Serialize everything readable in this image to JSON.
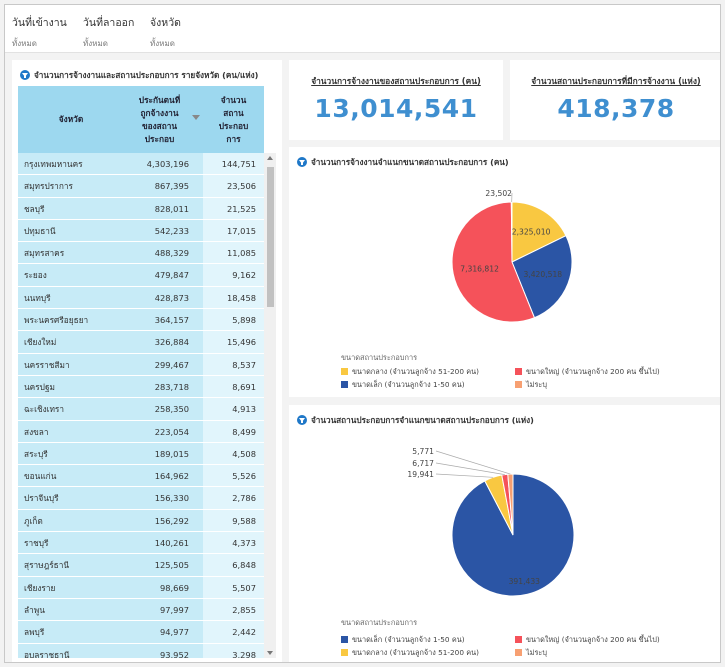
{
  "filters": [
    {
      "label": "วันที่เข้างาน",
      "value": "ทั้งหมด"
    },
    {
      "label": "วันที่ลาออก",
      "value": "ทั้งหมด"
    },
    {
      "label": "จังหวัด",
      "value": "ทั้งหมด"
    }
  ],
  "table_panel": {
    "title": "จำนวนการจ้างงานและสถานประกอบการ รายจังหวัด (คน/แห่ง)",
    "columns": [
      "จังหวัด",
      "ประกันตนที่ถูกจ้างงานของสถานประกอบ",
      "จำนวนสถานประกอบการ"
    ],
    "rows": [
      {
        "province": "กรุงเทพมหานคร",
        "insured": "4,303,196",
        "establishments": "144,751"
      },
      {
        "province": "สมุทรปราการ",
        "insured": "867,395",
        "establishments": "23,506"
      },
      {
        "province": "ชลบุรี",
        "insured": "828,011",
        "establishments": "21,525"
      },
      {
        "province": "ปทุมธานี",
        "insured": "542,233",
        "establishments": "17,015"
      },
      {
        "province": "สมุทรสาคร",
        "insured": "488,329",
        "establishments": "11,085"
      },
      {
        "province": "ระยอง",
        "insured": "479,847",
        "establishments": "9,162"
      },
      {
        "province": "นนทบุรี",
        "insured": "428,873",
        "establishments": "18,458"
      },
      {
        "province": "พระนครศรีอยุธยา",
        "insured": "364,157",
        "establishments": "5,898"
      },
      {
        "province": "เชียงใหม่",
        "insured": "326,884",
        "establishments": "15,496"
      },
      {
        "province": "นครราชสีมา",
        "insured": "299,467",
        "establishments": "8,537"
      },
      {
        "province": "นครปฐม",
        "insured": "283,718",
        "establishments": "8,691"
      },
      {
        "province": "ฉะเชิงเทรา",
        "insured": "258,350",
        "establishments": "4,913"
      },
      {
        "province": "สงขลา",
        "insured": "223,054",
        "establishments": "8,499"
      },
      {
        "province": "สระบุรี",
        "insured": "189,015",
        "establishments": "4,508"
      },
      {
        "province": "ขอนแก่น",
        "insured": "164,962",
        "establishments": "5,526"
      },
      {
        "province": "ปราจีนบุรี",
        "insured": "156,330",
        "establishments": "2,786"
      },
      {
        "province": "ภูเก็ต",
        "insured": "156,292",
        "establishments": "9,588"
      },
      {
        "province": "ราชบุรี",
        "insured": "140,261",
        "establishments": "4,373"
      },
      {
        "province": "สุราษฎร์ธานี",
        "insured": "125,505",
        "establishments": "6,848"
      },
      {
        "province": "เชียงราย",
        "insured": "98,669",
        "establishments": "5,507"
      },
      {
        "province": "ลำพูน",
        "insured": "97,997",
        "establishments": "2,855"
      },
      {
        "province": "ลพบุรี",
        "insured": "94,977",
        "establishments": "2,442"
      },
      {
        "province": "อุบลราชธานี",
        "insured": "93,952",
        "establishments": "3,298"
      }
    ]
  },
  "kpis": [
    {
      "label": "จำนวนการจ้างงานของสถานประกอบการ (คน)",
      "value": "13,014,541"
    },
    {
      "label": "จำนวนสถานประกอบการที่มีการจ้างงาน (แห่ง)",
      "value": "418,378"
    }
  ],
  "chart_data": [
    {
      "type": "pie",
      "title": "จำนวนการจ้างงานจำแนกขนาดสถานประกอบการ (คน)",
      "legend_title": "ขนาดสถานประกอบการ",
      "legend_position": "bottom",
      "start_from": "top",
      "slices": [
        {
          "name": "ขนาดกลาง (จำนวนลูกจ้าง 51-200 คน)",
          "value": 2325010,
          "label": "2,325,010",
          "color": "#f9c841"
        },
        {
          "name": "ขนาดเล็ก (จำนวนลูกจ้าง 1-50 คน)",
          "value": 3420518,
          "label": "3,420,518",
          "color": "#2b55a5"
        },
        {
          "name": "ขนาดใหญ่ (จำนวนลูกจ้าง 200 คน ขึ้นไป)",
          "value": 7316812,
          "label": "7,316,812",
          "color": "#f5525a"
        },
        {
          "name": "ไม่ระบุ",
          "value": 23502,
          "label": "23,502",
          "color": "#f7a072"
        }
      ],
      "legend_order": [
        0,
        2,
        1,
        3
      ]
    },
    {
      "type": "pie",
      "title": "จำนวนสถานประกอบการจำแนกขนาดสถานประกอบการ (แห่ง)",
      "legend_title": "ขนาดสถานประกอบการ",
      "legend_position": "bottom",
      "start_from": "top",
      "slices": [
        {
          "name": "ขนาดเล็ก (จำนวนลูกจ้าง 1-50 คน)",
          "value": 391433,
          "label": "391,433",
          "color": "#2b55a5"
        },
        {
          "name": "ขนาดกลาง (จำนวนลูกจ้าง 51-200 คน)",
          "value": 19941,
          "label": "19,941",
          "color": "#f9c841"
        },
        {
          "name": "ขนาดใหญ่ (จำนวนลูกจ้าง 200 คน ขึ้นไป)",
          "value": 6717,
          "label": "6,717",
          "color": "#f5525a"
        },
        {
          "name": "ไม่ระบุ",
          "value": 5771,
          "label": "5,771",
          "color": "#f7a072"
        }
      ],
      "legend_order": [
        0,
        2,
        1,
        3
      ]
    }
  ]
}
